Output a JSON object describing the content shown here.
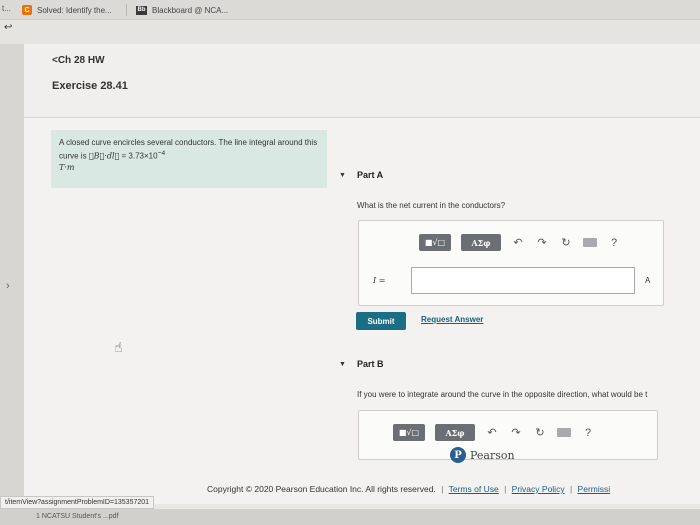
{
  "tabs": {
    "left_fragment": "t...",
    "tab1_label": "Solved: Identify the...",
    "tab1_icon": "C",
    "tab2_label": "Blackboard @ NCA...",
    "tab2_icon": "Bb"
  },
  "nav": {
    "back_arrow": "↩",
    "breadcrumb": "<Ch 28 HW",
    "exercise_title": "Exercise 28.41"
  },
  "problem": {
    "text1": "A closed curve encircles several conductors. The line integral around this curve is ",
    "integral": "∮B⃗·dl⃗",
    "text2": " = 3.73×10",
    "exponent": "−4",
    "unit": "T·m"
  },
  "partA": {
    "title": "Part A",
    "question": "What is the net current in the conductors?",
    "variable": "I =",
    "unit": "A",
    "submit_label": "Submit",
    "request_label": "Request Answer"
  },
  "partB": {
    "title": "Part B",
    "question": "If you were to integrate around the curve in the opposite direction, what would be t"
  },
  "toolbar": {
    "template_icon": "■√□",
    "greek_label": "ΑΣφ",
    "undo_icon": "↶",
    "redo_icon": "↷",
    "reset_icon": "↻",
    "help_icon": "?"
  },
  "pearson": {
    "logo_letter": "P",
    "name": "Pearson"
  },
  "footer": {
    "copyright": "Copyright © 2020 Pearson Education Inc. All rights reserved.",
    "terms": "Terms of Use",
    "privacy": "Privacy Policy",
    "permissions": "Permissi"
  },
  "statusbar": {
    "url": "t/itemView?assignmentProblemID=135357201"
  },
  "downloads": {
    "item": "1 NCATSU Student's ...pdf"
  },
  "colors": {
    "accent": "#1a6f86",
    "link": "#1a5d86",
    "problem_bg": "#d9e8e2"
  }
}
